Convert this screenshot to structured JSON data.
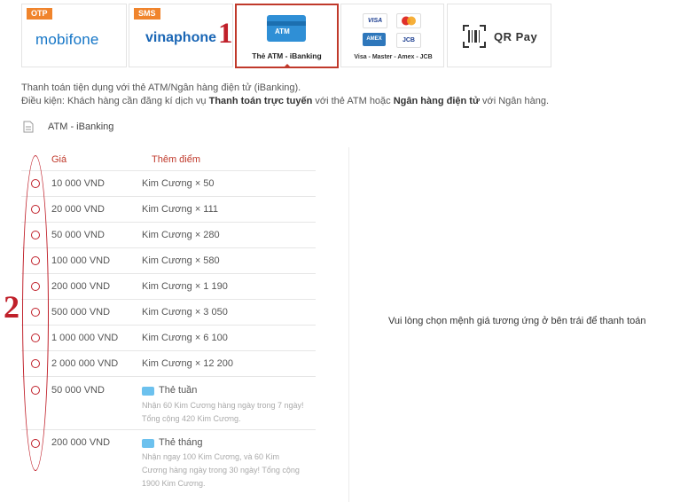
{
  "tabs": [
    {
      "id": "mobifone",
      "badge": "OTP",
      "brand": "mobifone"
    },
    {
      "id": "vinaphone",
      "badge": "SMS",
      "brand": "vinaphone"
    },
    {
      "id": "atm",
      "label": "Thẻ ATM - iBanking",
      "card_text": "ATM"
    },
    {
      "id": "visa",
      "label": "Visa - Master - Amex - JCB",
      "logos": [
        "VISA",
        "MC",
        "AMEX",
        "JCB"
      ]
    },
    {
      "id": "qr",
      "label": "QR Pay"
    }
  ],
  "annotations": {
    "one": "1",
    "two": "2"
  },
  "description": {
    "line1": "Thanh toán tiện dụng với thẻ ATM/Ngân hàng điện tử (iBanking).",
    "line2_pre": "Điều kiện: Khách hàng cần đăng kí dịch vụ ",
    "line2_bold1": "Thanh toán trực tuyến",
    "line2_mid": " với thẻ ATM hoặc ",
    "line2_bold2": "Ngân hàng điện tử",
    "line2_post": " với Ngân hàng."
  },
  "method_title": "ATM - iBanking",
  "table": {
    "header_price": "Giá",
    "header_bonus": "Thêm điểm",
    "rows": [
      {
        "price": "10 000 VND",
        "bonus": "Kim Cương × 50"
      },
      {
        "price": "20 000 VND",
        "bonus": "Kim Cương × 111"
      },
      {
        "price": "50 000 VND",
        "bonus": "Kim Cương × 280"
      },
      {
        "price": "100 000 VND",
        "bonus": "Kim Cương × 580"
      },
      {
        "price": "200 000 VND",
        "bonus": "Kim Cương × 1 190"
      },
      {
        "price": "500 000 VND",
        "bonus": "Kim Cương × 3 050"
      },
      {
        "price": "1 000 000 VND",
        "bonus": "Kim Cương × 6 100"
      },
      {
        "price": "2 000 000 VND",
        "bonus": "Kim Cương × 12 200"
      }
    ],
    "packages": [
      {
        "price": "50 000 VND",
        "name": "Thẻ tuần",
        "desc1": "Nhận 60 Kim Cương hàng ngày trong 7 ngày!",
        "desc2": "Tổng cộng 420 Kim Cương."
      },
      {
        "price": "200 000 VND",
        "name": "Thẻ tháng",
        "desc1": "Nhận ngay 100 Kim Cương, và 60 Kim",
        "desc2": "Cương hàng ngày trong 30 ngày! Tổng cộng",
        "desc3": "1900 Kim Cương."
      }
    ]
  },
  "hint": "Vui lòng chọn mệnh giá tương ứng ở bên trái để thanh toán"
}
